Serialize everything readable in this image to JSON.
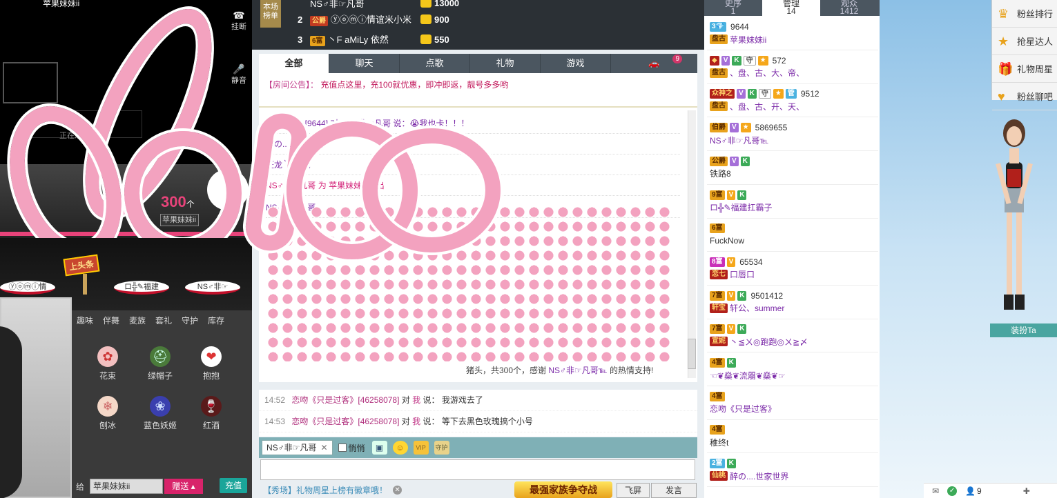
{
  "video": {
    "top_text": "苹果妹妹ii",
    "hangup": "挂断",
    "mute": "静音",
    "watching": "正在观",
    "count": "300",
    "count_unit": "个",
    "nick": "苹果妹妹ii"
  },
  "stage": {
    "top_sign": "上头条",
    "podiums": [
      "ⓨⓞⓜⓘ情",
      "ロ╬✎福建",
      "NS♂非☞"
    ]
  },
  "gift_panel": {
    "tabs": [
      "趣味",
      "伴舞",
      "麦族",
      "套礼",
      "守护",
      "库存"
    ],
    "items": [
      {
        "name": "花束",
        "icon": "rose-bouquet-icon",
        "glyph": "✿"
      },
      {
        "name": "绿帽子",
        "icon": "green-hat-icon",
        "glyph": "⛑"
      },
      {
        "name": "抱抱",
        "icon": "hug-cat-icon",
        "glyph": "❤"
      },
      {
        "name": "刨冰",
        "icon": "shaved-ice-icon",
        "glyph": "❄"
      },
      {
        "name": "蓝色妖姬",
        "icon": "blue-rose-icon",
        "glyph": "❀"
      },
      {
        "name": "红酒",
        "icon": "red-wine-icon",
        "glyph": "🍷"
      }
    ],
    "give_label": "给",
    "give_target": "苹果妹妹ii",
    "give_button": "赠送",
    "recharge": "充值"
  },
  "rank": {
    "label": "本场榜单",
    "rows": [
      {
        "no": "",
        "badge": "",
        "name": "NS♂非☞凡哥",
        "value": "13000"
      },
      {
        "no": "2",
        "badge": "公爵",
        "name": "ⓨⓞⓜⓘ情谊米小米",
        "value": "900"
      },
      {
        "no": "3",
        "badge": "6富",
        "name": "丶F aMiLy 依然",
        "value": "550"
      }
    ]
  },
  "chat": {
    "tabs": [
      {
        "label": "全部",
        "active": true
      },
      {
        "label": "聊天",
        "active": false
      },
      {
        "label": "点歌",
        "active": false
      },
      {
        "label": "礼物",
        "active": false
      },
      {
        "label": "游戏",
        "active": false
      },
      {
        "label": "",
        "badge": "9",
        "icon": "car-icon"
      }
    ],
    "notice_label": "【房间公告】：",
    "notice_text": "充值点这里，充100就优惠，即冲即返，靓号多多哟",
    "messages": [
      "苹果妹妹ii [9644] 对 NS♂非☞凡哥 说：😭我也卡！！！",
      "醉の....世家世界",
      "狂龙 ╲♬♪风",
      "NS♂非☞凡哥 为 苹果妹妹ii 送出",
      "NS♂非☞凡哥"
    ],
    "thanks_prefix": "猪头，共300个，感谢",
    "thanks_name": "NS♂非☞凡哥℡",
    "thanks_suffix": "的热情支持!",
    "private": [
      {
        "time": "14:52",
        "name": "恋吻《只是过客》[46258078]",
        "to": "对",
        "you": "我",
        "said": "说：",
        "text": "我游戏去了"
      },
      {
        "time": "14:53",
        "name": "恋吻《只是过客》[46258078]",
        "to": "对",
        "you": "我",
        "said": "说：",
        "text": "等下去黑色玫瑰搞个小号"
      }
    ],
    "target": "NS♂非☞凡哥",
    "whisper": "悄悄",
    "promo": "【秀场】礼物周星上榜有徽章哦！",
    "banner": "最强家族争夺战",
    "fly_button": "飞屏",
    "send_button": "发言"
  },
  "users": {
    "tabs": [
      {
        "label": "史序",
        "count": "1"
      },
      {
        "label": "管理",
        "count": "14"
      },
      {
        "label": "观众",
        "count": "1412"
      }
    ],
    "list": [
      {
        "badges": [
          {
            "t": "3💎",
            "c": "ub-o"
          }
        ],
        "id": "9644",
        "badge2": "盘古",
        "nick": "苹果妹妹ii"
      },
      {
        "badges": [
          {
            "t": "◆",
            "c": "ub-red"
          },
          {
            "t": "V",
            "c": "ub-v"
          },
          {
            "t": "K",
            "c": "ub-k"
          },
          {
            "t": "守",
            "c": "ub-s"
          },
          {
            "t": "★",
            "c": "ub-star"
          }
        ],
        "id": "572",
        "badge2": "盘古",
        "nick": "、盘、古、大、帝、"
      },
      {
        "badges": [
          {
            "t": "众神之",
            "c": "ub-red"
          },
          {
            "t": "V",
            "c": "ub-v"
          },
          {
            "t": "K",
            "c": "ub-k"
          },
          {
            "t": "守",
            "c": "ub-s"
          },
          {
            "t": "★",
            "c": "ub-star"
          },
          {
            "t": "管",
            "c": "ub-o"
          }
        ],
        "id": "9512",
        "badge2": "盘古",
        "nick": "、盘、古、开、天、"
      },
      {
        "badges": [
          {
            "t": "伯爵",
            "c": "ub-gold"
          },
          {
            "t": "V",
            "c": "ub-v"
          },
          {
            "t": "★",
            "c": "ub-star"
          }
        ],
        "id": "5869655",
        "badge2": "",
        "nick": "NS♂非☞凡哥℡"
      },
      {
        "badges": [
          {
            "t": "公爵",
            "c": "ub-gold"
          },
          {
            "t": "V",
            "c": "ub-v"
          },
          {
            "t": "K",
            "c": "ub-k"
          }
        ],
        "id": "",
        "badge2": "",
        "nick": "铁路8"
      },
      {
        "badges": [
          {
            "t": "9富",
            "c": "ub-gold"
          },
          {
            "t": "V",
            "c": "ub-star"
          },
          {
            "t": "K",
            "c": "ub-k"
          }
        ],
        "id": "",
        "badge2": "",
        "nick": "ロ╬✎福建扛霸子"
      },
      {
        "badges": [
          {
            "t": "6富",
            "c": "ub-gold"
          }
        ],
        "id": "",
        "badge2": "",
        "nick": "FuckNow"
      },
      {
        "badges": [
          {
            "t": "8富",
            "c": "ub-pink"
          },
          {
            "t": "V",
            "c": "ub-star"
          }
        ],
        "id": "65534",
        "badge2": "恋七",
        "nick": "口唇口"
      },
      {
        "badges": [
          {
            "t": "7富",
            "c": "ub-gold"
          },
          {
            "t": "V",
            "c": "ub-star"
          },
          {
            "t": "K",
            "c": "ub-k"
          }
        ],
        "id": "9501412",
        "badge2": "轩宝",
        "nick": "轩公、summer"
      },
      {
        "badges": [
          {
            "t": "7富",
            "c": "ub-gold"
          },
          {
            "t": "V",
            "c": "ub-star"
          },
          {
            "t": "K",
            "c": "ub-k"
          }
        ],
        "id": "",
        "badge2": "宣妮",
        "nick": "丶≦ㄨ◎跑跑◎ㄨ≧〆"
      },
      {
        "badges": [
          {
            "t": "4富",
            "c": "ub-gold"
          },
          {
            "t": "K",
            "c": "ub-k"
          }
        ],
        "id": "",
        "badge2": "",
        "nick": "☜❦燊❦流朤❦燊❦☞"
      },
      {
        "badges": [
          {
            "t": "4富",
            "c": "ub-gold"
          }
        ],
        "id": "",
        "badge2": "",
        "nick": "恋吻《只是过客》"
      },
      {
        "badges": [
          {
            "t": "4富",
            "c": "ub-gold"
          }
        ],
        "id": "",
        "badge2": "",
        "nick": "稚终t"
      },
      {
        "badges": [
          {
            "t": "2富",
            "c": "ub-o"
          },
          {
            "t": "K",
            "c": "ub-k"
          }
        ],
        "id": "",
        "badge2": "仙桃",
        "nick": "醉の....世家世界"
      }
    ]
  },
  "fan_menu": [
    {
      "label": "粉丝排行",
      "icon": "crown-icon",
      "glyph": "♛"
    },
    {
      "label": "抢星达人",
      "icon": "star-icon",
      "glyph": "★"
    },
    {
      "label": "礼物周星",
      "icon": "gift-icon",
      "glyph": "🎁"
    },
    {
      "label": "粉丝聊吧",
      "icon": "heart-icon",
      "glyph": "♥"
    }
  ],
  "dress_button": "装扮Ta",
  "status": {
    "count": "9"
  }
}
